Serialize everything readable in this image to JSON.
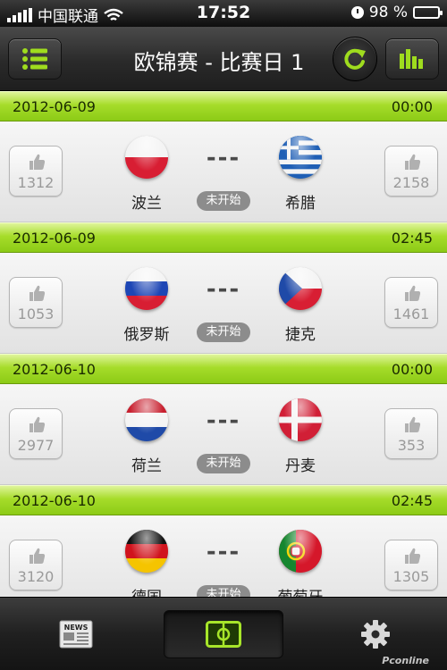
{
  "status_bar": {
    "carrier": "中国联通",
    "time": "17:52",
    "battery_text": "98 %",
    "battery_level": 0.98
  },
  "nav": {
    "title": "欧锦赛 - 比赛日 1",
    "accent": "#9fdc1e"
  },
  "matches": [
    {
      "date": "2012-06-09",
      "time": "00:00",
      "home": "波兰",
      "away": "希腊",
      "home_votes": "1312",
      "away_votes": "2158",
      "score": "---",
      "status": "未开始",
      "home_flag": "poland",
      "away_flag": "greece"
    },
    {
      "date": "2012-06-09",
      "time": "02:45",
      "home": "俄罗斯",
      "away": "捷克",
      "home_votes": "1053",
      "away_votes": "1461",
      "score": "---",
      "status": "未开始",
      "home_flag": "russia",
      "away_flag": "czech"
    },
    {
      "date": "2012-06-10",
      "time": "00:00",
      "home": "荷兰",
      "away": "丹麦",
      "home_votes": "2977",
      "away_votes": "353",
      "score": "---",
      "status": "未开始",
      "home_flag": "netherlands",
      "away_flag": "denmark"
    },
    {
      "date": "2012-06-10",
      "time": "02:45",
      "home": "德国",
      "away": "葡萄牙",
      "home_votes": "3120",
      "away_votes": "1305",
      "score": "---",
      "status": "未开始",
      "home_flag": "germany",
      "away_flag": "portugal"
    }
  ],
  "tabbar": {
    "news_icon_text": "NEWS",
    "watermark": "Pconline"
  }
}
